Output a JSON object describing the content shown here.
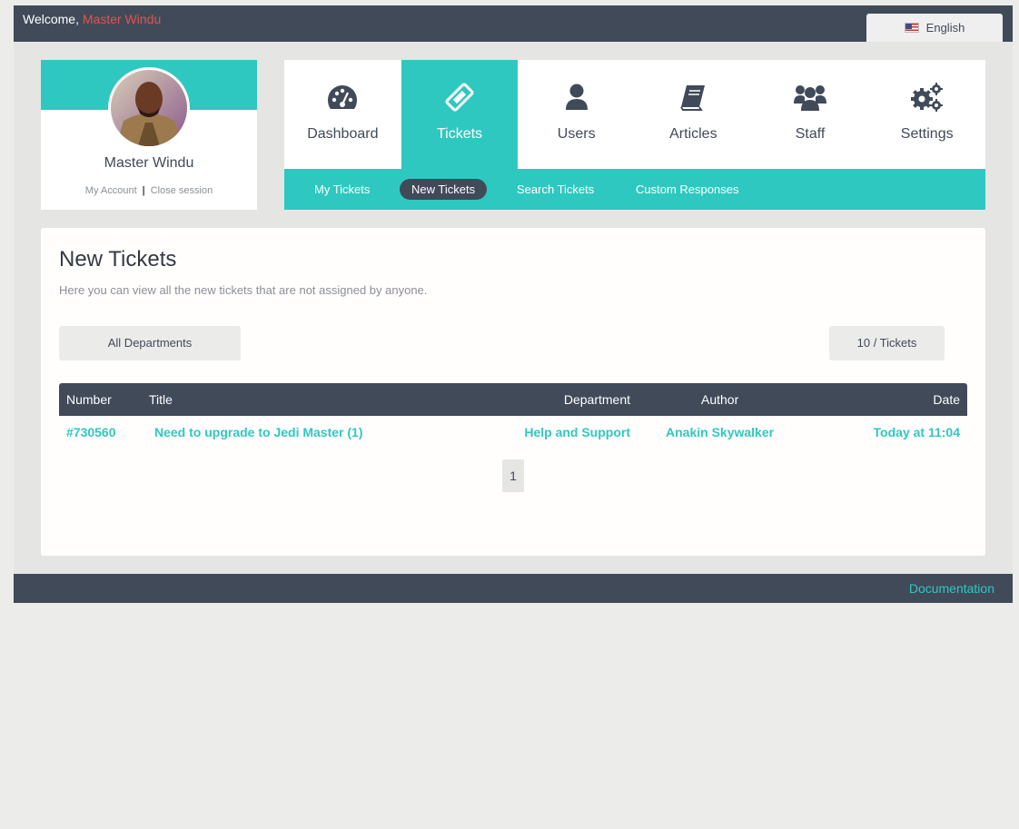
{
  "header": {
    "welcome_label": "Welcome,",
    "user_name": "Master Windu",
    "language": "English"
  },
  "profile": {
    "name": "Master Windu",
    "my_account": "My Account",
    "separator": "|",
    "close_session": "Close session"
  },
  "nav": {
    "items": [
      {
        "label": "Dashboard",
        "icon": "dashboard-icon"
      },
      {
        "label": "Tickets",
        "icon": "ticket-icon"
      },
      {
        "label": "Users",
        "icon": "user-icon"
      },
      {
        "label": "Articles",
        "icon": "book-icon"
      },
      {
        "label": "Staff",
        "icon": "group-icon"
      },
      {
        "label": "Settings",
        "icon": "gears-icon"
      }
    ],
    "active": "Tickets"
  },
  "subnav": {
    "items": [
      "My Tickets",
      "New Tickets",
      "Search Tickets",
      "Custom Responses"
    ],
    "active": "New Tickets"
  },
  "page": {
    "title": "New Tickets",
    "description": "Here you can view all the new tickets that are not assigned by anyone.",
    "department_filter": "All Departments",
    "page_size": "10 / Tickets"
  },
  "table": {
    "columns": [
      "Number",
      "Title",
      "Department",
      "Author",
      "Date"
    ],
    "rows": [
      {
        "number": "#730560",
        "title": "Need to upgrade to Jedi Master (1)",
        "department": "Help and Support",
        "author": "Anakin Skywalker",
        "date": "Today at 11:04"
      }
    ]
  },
  "pagination": {
    "current": "1"
  },
  "footer": {
    "documentation": "Documentation"
  },
  "colors": {
    "accent": "#2fc8c0",
    "dark": "#414a59",
    "username": "#e2524f"
  }
}
